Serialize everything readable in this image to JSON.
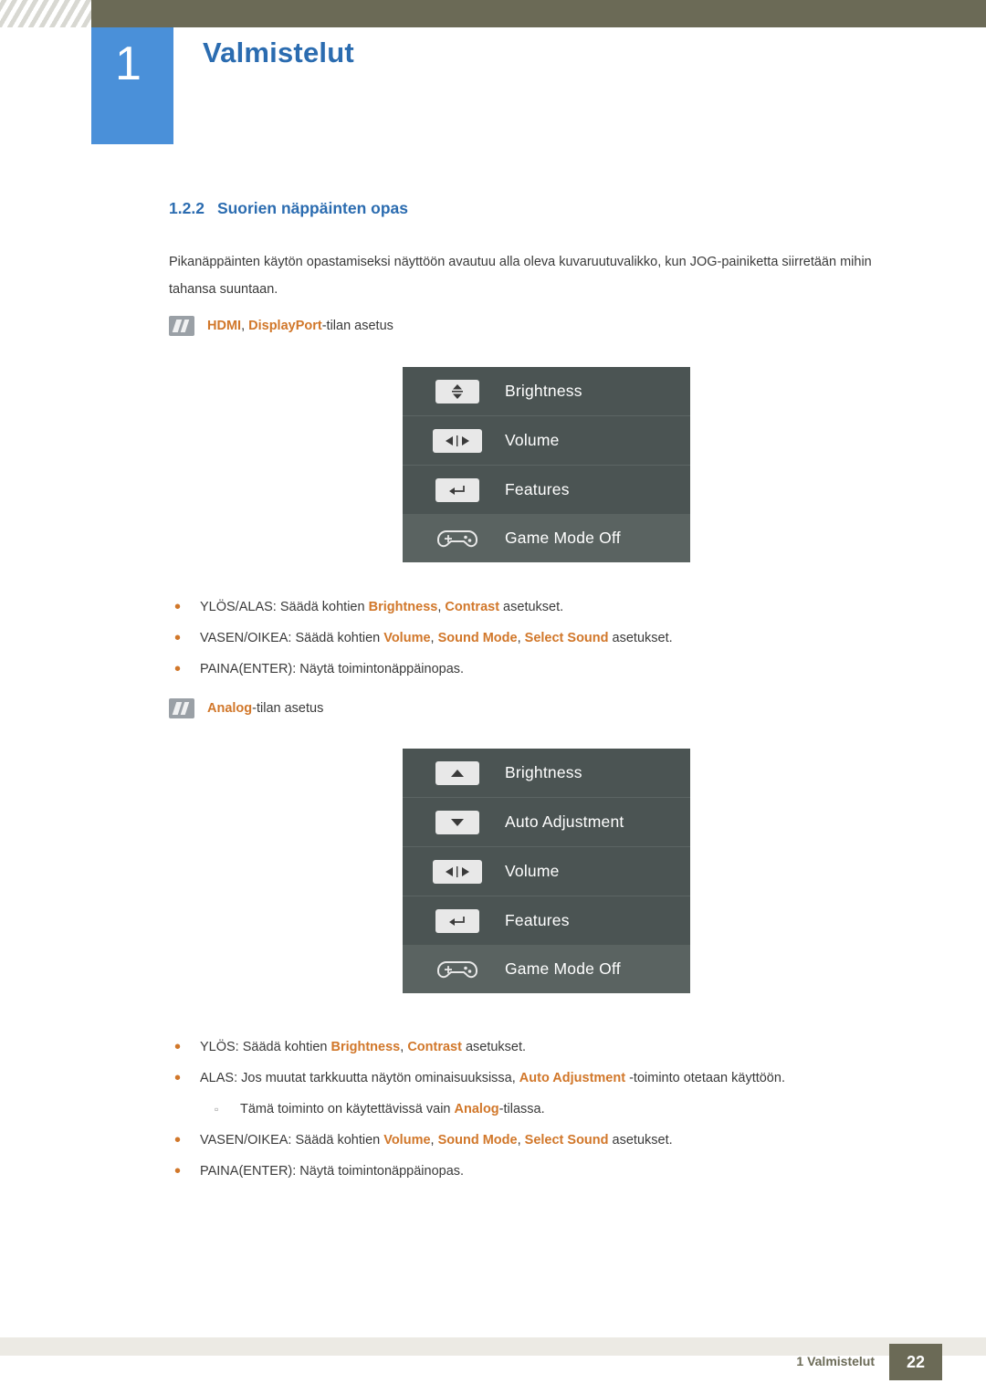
{
  "header": {
    "chapter_number": "1",
    "chapter_title": "Valmistelut"
  },
  "section": {
    "number": "1.2.2",
    "title": "Suorien näppäinten opas",
    "paragraph": "Pikanäppäinten käytön opastamiseksi näyttöön avautuu alla oleva kuvaruutuvalikko, kun JOG-painiketta siirretään mihin tahansa suuntaan."
  },
  "note1": {
    "icon": "note-icon",
    "prefix_a": "HDMI",
    "sep": ", ",
    "prefix_b": "DisplayPort",
    "suffix": "-tilan asetus"
  },
  "osd1": {
    "rows": [
      {
        "icon": "up-down-arrow-icon",
        "label": "Brightness"
      },
      {
        "icon": "left-right-arrow-icon",
        "label": "Volume"
      },
      {
        "icon": "enter-arrow-icon",
        "label": "Features"
      },
      {
        "icon": "gamepad-icon",
        "label": "Game Mode Off"
      }
    ]
  },
  "bullets1": [
    {
      "parts": [
        {
          "t": "YLÖS/ALAS: Säädä kohtien ",
          "s": "normal"
        },
        {
          "t": "Brightness",
          "s": "orange"
        },
        {
          "t": ", ",
          "s": "normal"
        },
        {
          "t": "Contrast",
          "s": "orange"
        },
        {
          "t": " asetukset.",
          "s": "normal"
        }
      ]
    },
    {
      "parts": [
        {
          "t": "VASEN/OIKEA: Säädä kohtien ",
          "s": "normal"
        },
        {
          "t": "Volume",
          "s": "orange"
        },
        {
          "t": ", ",
          "s": "normal"
        },
        {
          "t": "Sound Mode",
          "s": "orange"
        },
        {
          "t": ", ",
          "s": "normal"
        },
        {
          "t": "Select Sound",
          "s": "orange"
        },
        {
          "t": " asetukset.",
          "s": "normal"
        }
      ]
    },
    {
      "parts": [
        {
          "t": "PAINA(ENTER): Näytä toimintonäppäinopas.",
          "s": "normal"
        }
      ]
    }
  ],
  "note2": {
    "icon": "note-icon",
    "prefix_a": "Analog",
    "suffix": "-tilan asetus"
  },
  "osd2": {
    "rows": [
      {
        "icon": "up-arrow-icon",
        "label": "Brightness"
      },
      {
        "icon": "down-arrow-icon",
        "label": "Auto Adjustment"
      },
      {
        "icon": "left-right-arrow-icon",
        "label": "Volume"
      },
      {
        "icon": "enter-arrow-icon",
        "label": "Features"
      },
      {
        "icon": "gamepad-icon",
        "label": "Game Mode Off"
      }
    ]
  },
  "bullets2": [
    {
      "sub": false,
      "parts": [
        {
          "t": "YLÖS: Säädä kohtien ",
          "s": "normal"
        },
        {
          "t": "Brightness",
          "s": "orange"
        },
        {
          "t": ", ",
          "s": "normal"
        },
        {
          "t": "Contrast",
          "s": "orange"
        },
        {
          "t": " asetukset.",
          "s": "normal"
        }
      ]
    },
    {
      "sub": false,
      "parts": [
        {
          "t": "ALAS: Jos muutat tarkkuutta näytön ominaisuuksissa, ",
          "s": "normal"
        },
        {
          "t": "Auto Adjustment",
          "s": "orange"
        },
        {
          "t": " -toiminto otetaan käyttöön.",
          "s": "normal"
        }
      ]
    },
    {
      "sub": true,
      "parts": [
        {
          "t": "Tämä toiminto on käytettävissä vain ",
          "s": "normal"
        },
        {
          "t": "Analog",
          "s": "orange"
        },
        {
          "t": "-tilassa.",
          "s": "normal"
        }
      ]
    },
    {
      "sub": false,
      "parts": [
        {
          "t": "VASEN/OIKEA: Säädä kohtien ",
          "s": "normal"
        },
        {
          "t": "Volume",
          "s": "orange"
        },
        {
          "t": ", ",
          "s": "normal"
        },
        {
          "t": "Sound Mode",
          "s": "orange"
        },
        {
          "t": ", ",
          "s": "normal"
        },
        {
          "t": "Select Sound",
          "s": "orange"
        },
        {
          "t": " asetukset.",
          "s": "normal"
        }
      ]
    },
    {
      "sub": false,
      "parts": [
        {
          "t": "PAINA(ENTER): Näytä toimintonäppäinopas.",
          "s": "normal"
        }
      ]
    }
  ],
  "footer": {
    "label": "1 Valmistelut",
    "page": "22"
  },
  "colors": {
    "header_bar": "#6b6a56",
    "chapter_badge": "#4a90d9",
    "title_blue": "#2b6cb0",
    "accent_orange": "#d1772a",
    "osd_bg": "#4b5453",
    "osd_row_highlight": "#5a6361"
  }
}
